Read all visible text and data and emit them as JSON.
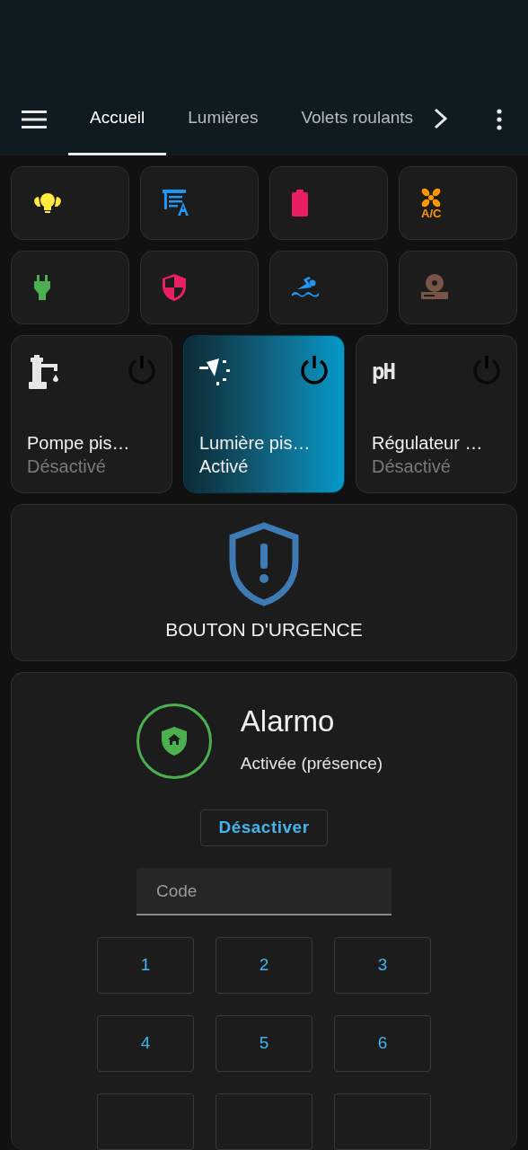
{
  "tabs": [
    {
      "label": "Accueil",
      "selected": true
    },
    {
      "label": "Lumières",
      "selected": false
    },
    {
      "label": "Volets roulants",
      "selected": false
    }
  ],
  "quick_tiles": [
    {
      "kind": "bulbs",
      "color": "#ffeb3b"
    },
    {
      "kind": "shutter",
      "color": "#2196f3"
    },
    {
      "kind": "battery",
      "color": "#e91e63"
    },
    {
      "kind": "ac",
      "color": "#ff9800",
      "icon_label": "A/C"
    },
    {
      "kind": "plug",
      "color": "#4caf50"
    },
    {
      "kind": "shield",
      "color": "#e91e63"
    },
    {
      "kind": "swimmer",
      "color": "#2196f3"
    },
    {
      "kind": "media",
      "color": "#795548"
    }
  ],
  "switches": [
    {
      "kind": "faucet",
      "name": "Pompe pis…",
      "state": "Désactivé",
      "on": false
    },
    {
      "kind": "spotlight",
      "name": "Lumière pis…",
      "state": "Activé",
      "on": true
    },
    {
      "kind": "ph",
      "icon_label": "pH",
      "name": "Régulateur …",
      "state": "Désactivé",
      "on": false
    }
  ],
  "emergency": {
    "label": "BOUTON D'URGENCE"
  },
  "alarm": {
    "title": "Alarmo",
    "status": "Activée (présence)",
    "action": "Désactiver",
    "code_placeholder": "Code",
    "keys": [
      "1",
      "2",
      "3",
      "4",
      "5",
      "6"
    ]
  }
}
